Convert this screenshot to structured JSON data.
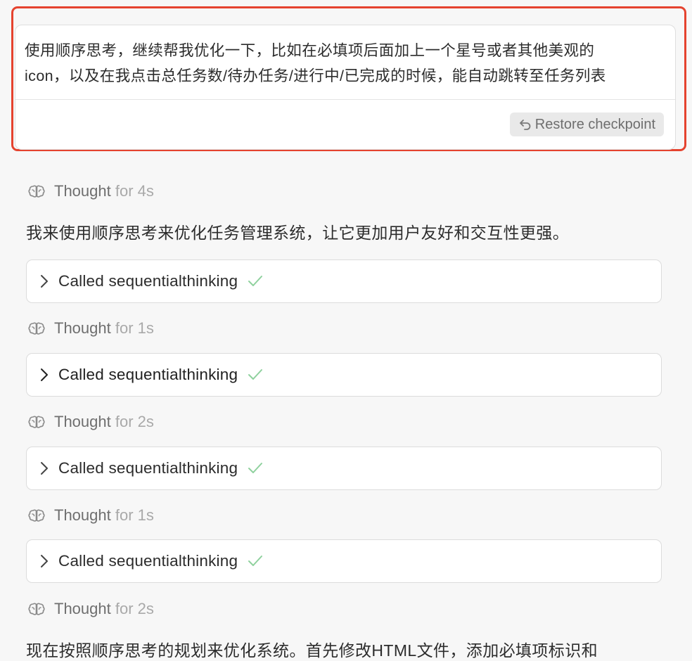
{
  "user_message": {
    "line1": "使用顺序思考，继续帮我优化一下，比如在必填项后面加上一个星号或者其他美观的",
    "line2": "icon，以及在我点击总任务数/待办任务/进行中/已完成的时候，能自动跳转至任务列表",
    "restore_label": "Restore checkpoint",
    "restore_icon": "undo-arrow-icon",
    "highlight_color": "#e5432f"
  },
  "thoughts": [
    {
      "label": "Thought",
      "duration": "for 4s",
      "icon": "brain-icon"
    },
    {
      "label": "Thought",
      "duration": "for 1s",
      "icon": "brain-icon"
    },
    {
      "label": "Thought",
      "duration": "for 2s",
      "icon": "brain-icon"
    },
    {
      "label": "Thought",
      "duration": "for 1s",
      "icon": "brain-icon"
    },
    {
      "label": "Thought",
      "duration": "for 2s",
      "icon": "brain-icon"
    }
  ],
  "assistant_text": {
    "intro": "我来使用顺序思考来优化任务管理系统，让它更加用户友好和交互性更强。",
    "followup": "现在按照顺序思考的规划来优化系统。首先修改HTML文件，添加必填项标识和"
  },
  "tool_calls": [
    {
      "label": "Called sequentialthinking",
      "status_icon": "check-icon",
      "expand_icon": "chevron-right-icon"
    },
    {
      "label": "Called sequentialthinking",
      "status_icon": "check-icon",
      "expand_icon": "chevron-right-icon"
    },
    {
      "label": "Called sequentialthinking",
      "status_icon": "check-icon",
      "expand_icon": "chevron-right-icon"
    },
    {
      "label": "Called sequentialthinking",
      "status_icon": "check-icon",
      "expand_icon": "chevron-right-icon"
    }
  ],
  "colors": {
    "background": "#f7f7f7",
    "check": "#8fd19e",
    "muted_text": "#a9a9a9"
  }
}
